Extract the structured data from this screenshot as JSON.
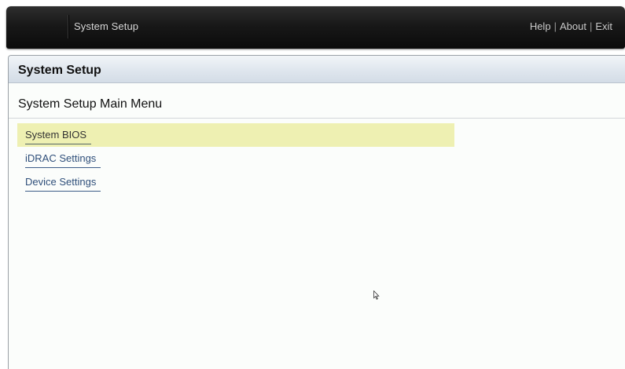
{
  "header": {
    "app_title": "System Setup",
    "help_link": "Help",
    "about_link": "About",
    "exit_link": "Exit",
    "separator": "|"
  },
  "panel": {
    "title": "System Setup"
  },
  "main_menu": {
    "heading": "System Setup Main Menu",
    "items": [
      {
        "label": "System BIOS",
        "selected": true
      },
      {
        "label": "iDRAC Settings",
        "selected": false
      },
      {
        "label": "Device Settings",
        "selected": false
      }
    ]
  },
  "colors": {
    "header_bg": "#111111",
    "selected_row": "#eef0b2",
    "link_text": "#2f4f7a",
    "panel_header": "#dfe6ee"
  },
  "icons": [
    "mouse-pointer-icon"
  ]
}
